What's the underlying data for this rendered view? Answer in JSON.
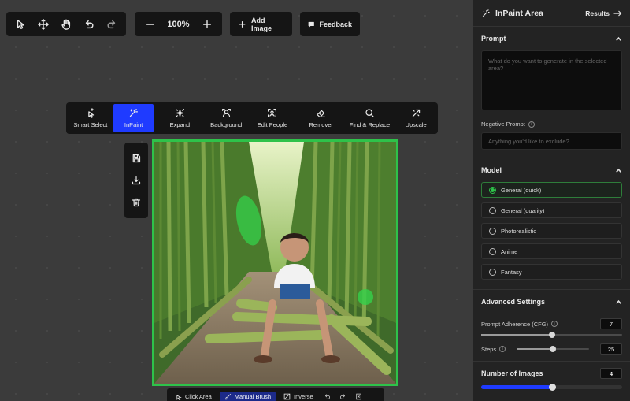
{
  "toolbar": {
    "zoom": "100%",
    "add_image": "Add Image",
    "feedback": "Feedback"
  },
  "modes": [
    {
      "label": "Smart Select",
      "icon": "sparkle-cursor-icon",
      "active": false
    },
    {
      "label": "InPaint",
      "icon": "magic-wand-icon",
      "active": true
    },
    {
      "label": "Expand",
      "icon": "expand-sparkle-icon",
      "active": false
    },
    {
      "label": "Background",
      "icon": "person-background-icon",
      "active": false
    },
    {
      "label": "Edit People",
      "icon": "face-scan-icon",
      "active": false
    },
    {
      "label": "Remover",
      "icon": "eraser-icon",
      "active": false
    },
    {
      "label": "Find & Replace",
      "icon": "search-icon",
      "active": false
    },
    {
      "label": "Upscale",
      "icon": "upscale-icon",
      "active": false
    }
  ],
  "bottom_bar": {
    "click_area": "Click Area",
    "manual_brush": "Manual Brush",
    "inverse": "Inverse"
  },
  "panel": {
    "title": "InPaint Area",
    "results": "Results",
    "prompt": {
      "heading": "Prompt",
      "placeholder": "What do you want to generate in the selected area?",
      "negative_label": "Negative Prompt",
      "negative_placeholder": "Anything you'd like to exclude?"
    },
    "model": {
      "heading": "Model",
      "options": [
        {
          "label": "General (quick)",
          "selected": true
        },
        {
          "label": "General (quality)",
          "selected": false
        },
        {
          "label": "Photorealistic",
          "selected": false
        },
        {
          "label": "Anime",
          "selected": false
        },
        {
          "label": "Fantasy",
          "selected": false
        }
      ]
    },
    "advanced": {
      "heading": "Advanced Settings",
      "cfg_label": "Prompt Adherence (CFG)",
      "cfg_value": "7",
      "cfg_fraction": 0.5,
      "steps_label": "Steps",
      "steps_value": "25",
      "steps_fraction": 0.5
    },
    "images": {
      "heading": "Number of Images",
      "value": "4",
      "fraction": 0.5
    }
  },
  "colors": {
    "accent_blue": "#1f3bff",
    "selection_green": "#2ec24a"
  }
}
